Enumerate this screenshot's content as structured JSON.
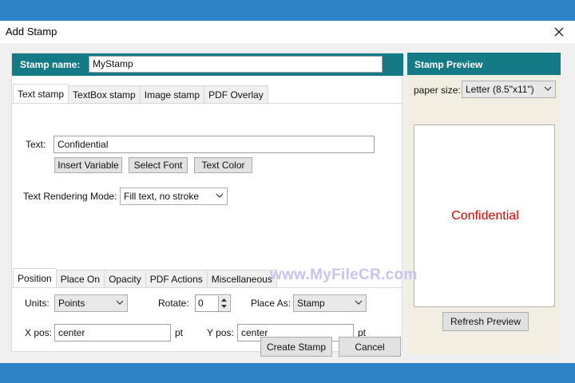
{
  "window": {
    "title": "Add Stamp"
  },
  "stamp_name": {
    "label": "Stamp name:",
    "value": "MyStamp"
  },
  "main_tabs": [
    "Text stamp",
    "TextBox stamp",
    "Image stamp",
    "PDF Overlay"
  ],
  "text_stamp": {
    "text_label": "Text:",
    "text_value": "Confidential",
    "insert_variable": "Insert Variable",
    "select_font": "Select Font",
    "text_color": "Text Color",
    "rendering_mode_label": "Text Rendering Mode:",
    "rendering_mode_value": "Fill text, no stroke"
  },
  "position_tabs": [
    "Position",
    "Place On",
    "Opacity",
    "PDF Actions",
    "Miscellaneous"
  ],
  "position": {
    "units_label": "Units:",
    "units_value": "Points",
    "rotate_label": "Rotate:",
    "rotate_value": "0",
    "place_as_label": "Place As:",
    "place_as_value": "Stamp",
    "xpos_label": "X pos:",
    "xpos_value": "center",
    "xpos_unit": "pt",
    "ypos_label": "Y pos:",
    "ypos_value": "center",
    "ypos_unit": "pt"
  },
  "preview": {
    "title": "Stamp Preview",
    "paper_size_label": "paper size:",
    "paper_size_value": "Letter (8.5\"x11\")",
    "preview_text": "Confidential",
    "refresh": "Refresh Preview"
  },
  "footer": {
    "create": "Create Stamp",
    "cancel": "Cancel"
  },
  "watermark": "www.MyFileCR.com",
  "colors": {
    "accent": "#147a86",
    "preview_text": "#e30000",
    "desktop": "#2e83c6"
  }
}
